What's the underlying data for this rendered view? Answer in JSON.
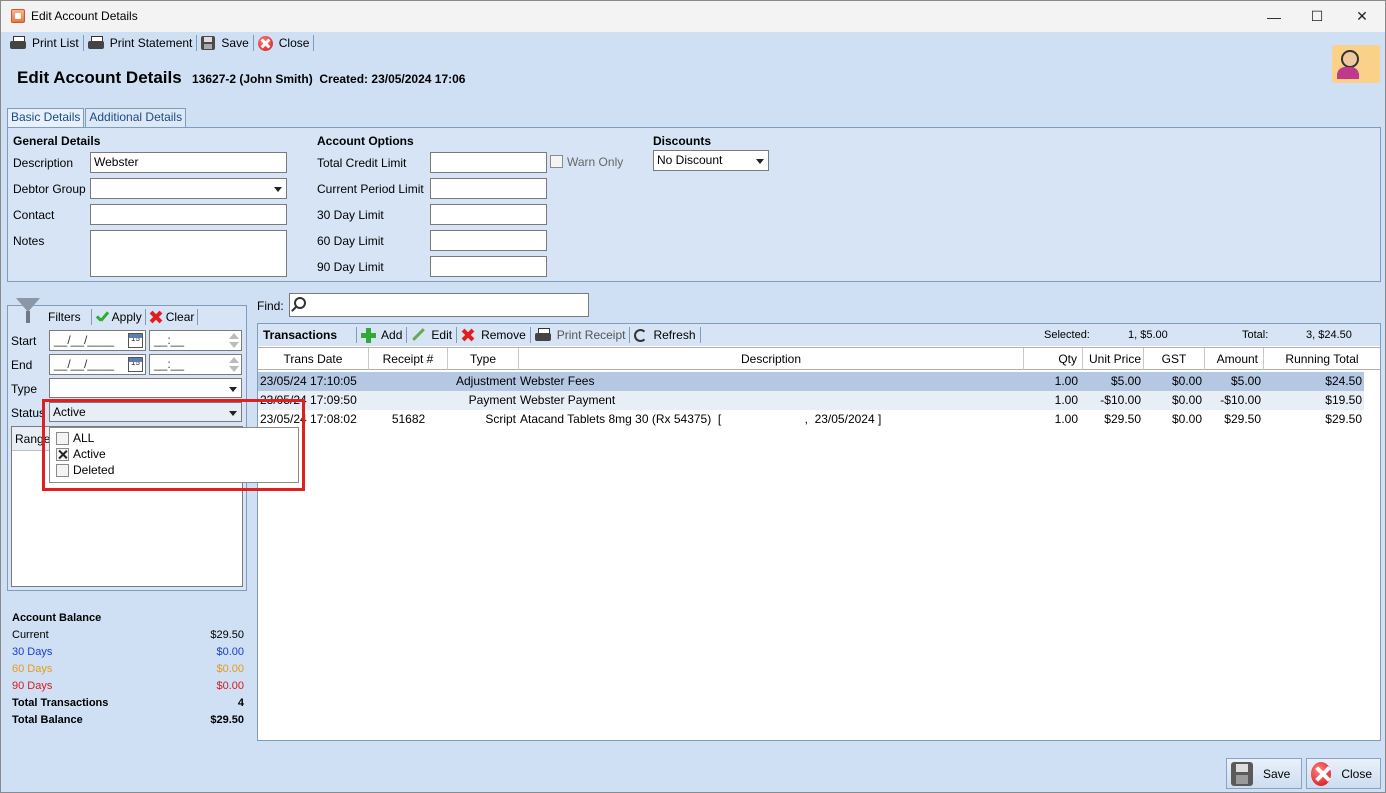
{
  "window": {
    "title": "Edit Account Details",
    "controls": {
      "minimize": "—",
      "maximize": "☐",
      "close": "✕"
    }
  },
  "toolbar": {
    "print_list": "Print List",
    "print_statement": "Print Statement",
    "save": "Save",
    "close": "Close"
  },
  "header": {
    "title": "Edit Account Details",
    "account": "13627-2 (John Smith)",
    "created": "Created: 23/05/2024 17:06"
  },
  "tabs": [
    "Basic Details",
    "Additional Details"
  ],
  "general": {
    "heading": "General Details",
    "description_label": "Description",
    "description_value": "Webster",
    "debtor_group_label": "Debtor Group",
    "debtor_group_value": "",
    "contact_label": "Contact",
    "contact_value": "",
    "notes_label": "Notes",
    "notes_value": ""
  },
  "account_options": {
    "heading": "Account Options",
    "total_credit_limit_label": "Total Credit Limit",
    "warn_only_label": "Warn Only",
    "current_period_limit_label": "Current Period Limit",
    "day30_label": "30 Day Limit",
    "day60_label": "60 Day Limit",
    "day90_label": "90 Day Limit"
  },
  "discounts": {
    "heading": "Discounts",
    "value": "No Discount"
  },
  "filters": {
    "title": "Filters",
    "apply": "Apply",
    "clear": "Clear",
    "start_label": "Start",
    "end_label": "End",
    "type_label": "Type",
    "status_label": "Status",
    "date_placeholder": "__/__/____",
    "time_placeholder": "__:__",
    "cal_day": "15",
    "status_value": "Active",
    "range_label": "Range"
  },
  "status_popup": {
    "options": [
      {
        "label": "ALL",
        "checked": false
      },
      {
        "label": "Active",
        "checked": true
      },
      {
        "label": "Deleted",
        "checked": false
      }
    ]
  },
  "account_balance": {
    "heading": "Account Balance",
    "current_label": "Current",
    "current_value": "$29.50",
    "d30_label": "30 Days",
    "d30_value": "$0.00",
    "d60_label": "60 Days",
    "d60_value": "$0.00",
    "d90_label": "90 Days",
    "d90_value": "$0.00",
    "total_trans_label": "Total Transactions",
    "total_trans_value": "4",
    "total_balance_label": "Total Balance",
    "total_balance_value": "$29.50",
    "colors": {
      "d30": "#1a3fc7",
      "d60": "#e89a1a",
      "d90": "#d61b1b"
    }
  },
  "find": {
    "label": "Find:"
  },
  "transactions": {
    "title": "Transactions",
    "add": "Add",
    "edit": "Edit",
    "remove": "Remove",
    "print_receipt": "Print Receipt",
    "refresh": "Refresh",
    "selected_label": "Selected:",
    "selected_value": "1, $5.00",
    "total_label": "Total:",
    "total_value": "3, $24.50",
    "columns": [
      "Trans Date",
      "Receipt #",
      "Type",
      "Description",
      "Qty",
      "Unit Price",
      "GST",
      "Amount",
      "Running Total"
    ],
    "rows": [
      {
        "date": "23/05/24 17:10:05",
        "receipt": "",
        "type": "Adjustment",
        "description": "Webster Fees",
        "qty": "1.00",
        "unit_price": "$5.00",
        "gst": "$0.00",
        "amount": "$5.00",
        "running": "$24.50"
      },
      {
        "date": "23/05/24 17:09:50",
        "receipt": "",
        "type": "Payment",
        "description": "Webster Payment",
        "qty": "1.00",
        "unit_price": "-$10.00",
        "gst": "$0.00",
        "amount": "-$10.00",
        "running": "$19.50"
      },
      {
        "date": "23/05/24 17:08:02",
        "receipt": "51682",
        "type": "Script",
        "description": "Atacand Tablets 8mg 30 (Rx 54375)  [                         ,  23/05/2024 ]",
        "qty": "1.00",
        "unit_price": "$29.50",
        "gst": "$0.00",
        "amount": "$29.50",
        "running": "$29.50"
      }
    ]
  },
  "footer": {
    "save": "Save",
    "close": "Close"
  }
}
